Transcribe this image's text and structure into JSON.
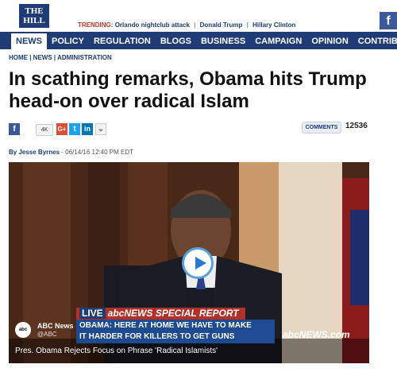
{
  "site": {
    "logo_line1": "THE",
    "logo_line2": "HILL"
  },
  "trending": {
    "label": "TRENDING:",
    "items": [
      "Orlando nightclub attack",
      "Donald Trump",
      "Hillary Clinton"
    ]
  },
  "nav": {
    "items": [
      "NEWS",
      "POLICY",
      "REGULATION",
      "BLOGS",
      "BUSINESS",
      "CAMPAIGN",
      "OPINION",
      "CONTRIBUTORS"
    ]
  },
  "breadcrumb": "HOME | NEWS | ADMINISTRATION",
  "article": {
    "title": "In scathing remarks, Obama hits Trump head-on over radical Islam",
    "author": "By Jesse Byrnes",
    "date": "- 06/14/16 12:40 PM EDT"
  },
  "share": {
    "count": "4K",
    "comments_label": "COMMENTS",
    "comments_count": "12536",
    "icons": [
      "facebook-icon",
      "google-plus-icon",
      "twitter-icon",
      "linkedin-icon",
      "more-icon"
    ]
  },
  "video": {
    "live_label": "LIVE",
    "network": "abcNEWS",
    "report_label": "SPECIAL REPORT",
    "lower_third_line1": "OBAMA: HERE AT HOME WE HAVE TO MAKE",
    "lower_third_line2": "IT HARDER FOR KILLERS TO GET GUNS",
    "watermark": "abcNEWS.com",
    "channel_name": "ABC News",
    "channel_handle": "@ABC",
    "caption": "Pres. Obama Rejects Focus on Phrase 'Radical Islamists'"
  },
  "colors": {
    "brand": "#1f3c76",
    "trending": "#c0392b"
  }
}
